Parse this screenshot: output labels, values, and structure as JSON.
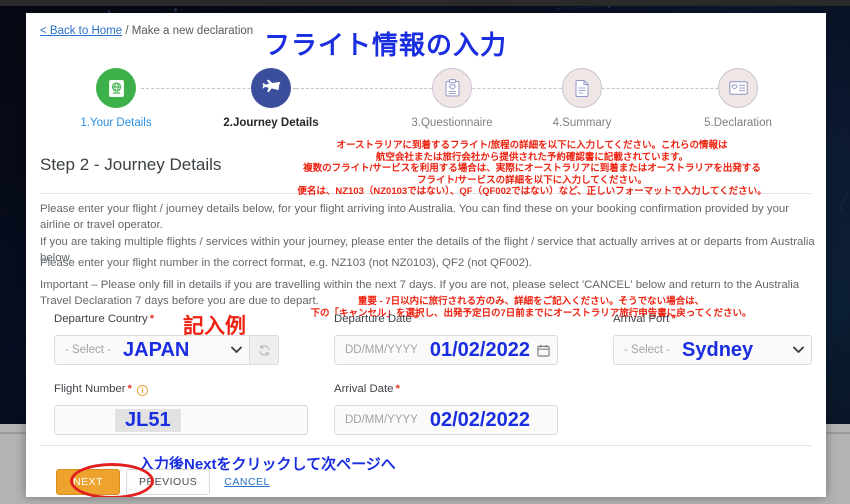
{
  "breadcrumb": {
    "back_link": "< Back to Home",
    "separator": " / ",
    "current": "Make a new declaration"
  },
  "annotations": {
    "title_jp": "フライト情報の入力",
    "red_note_lines": [
      "オーストラリアに到着するフライト/旅程の詳細を以下に入力してください。これらの情報は",
      "航空会社または旅行会社から提供された予約確認書に記載されています。",
      "複数のフライト/サービスを利用する場合は、実際にオーストラリアに到着またはオーストラリアを出発する",
      "フライト/サービスの詳細を以下に入力してください。",
      "便名は、NZ103（NZ0103ではない）、QF（QF002ではない）など、正しいフォーマットで入力してください。"
    ],
    "red_important_lines": [
      "重要 - 7日以内に旅行される方のみ、詳細をご記入ください。そうでない場合は、",
      "下の「キャンセル」を選択し、出発予定日の7日前までにオーストラリア旅行申告書に戻ってください。"
    ],
    "sample_label_jp": "記入例",
    "next_note_jp": "入力後Nextをクリックして次ページへ",
    "red_color": "#ee2211",
    "blue_color": "#1a2ee0"
  },
  "stepper": {
    "steps": [
      {
        "label": "1.Your Details",
        "icon": "passport-icon",
        "state": "done",
        "color": "#3cb14a"
      },
      {
        "label": "2.Journey Details",
        "icon": "airplane-icon",
        "state": "active",
        "color": "#3b4e9b"
      },
      {
        "label": "3.Questionnaire",
        "icon": "clipboard-icon",
        "state": "todo",
        "color": "#f0e6e6"
      },
      {
        "label": "4.Summary",
        "icon": "document-icon",
        "state": "todo",
        "color": "#f0e6e6"
      },
      {
        "label": "5.Declaration",
        "icon": "id-card-icon",
        "state": "todo",
        "color": "#f0e6e6"
      }
    ]
  },
  "page": {
    "heading": "Step 2 - Journey Details",
    "paragraphs": [
      "Please enter your flight / journey details below, for your flight arriving into Australia. You can find these on your booking confirmation provided by your airline or travel operator.",
      "If you are taking multiple flights / services within your journey, please enter the details of the flight / service that actually arrives at or departs from Australia below.",
      "Please enter your flight number in the correct format, e.g. NZ103 (not NZ0103), QF2 (not QF002).",
      "Important – Please only fill in details if you are travelling within the next 7 days.  If you are not, please select 'CANCEL' below and return to the Australia Travel Declaration 7 days before you are due to depart."
    ]
  },
  "form": {
    "departure_country": {
      "label": "Departure Country",
      "required": "*",
      "placeholder": "- Select -",
      "value": "JAPAN"
    },
    "departure_date": {
      "label": "Departure Date",
      "required": "*",
      "placeholder": "DD/MM/YYYY",
      "value": "01/02/2022"
    },
    "arrival_port": {
      "label": "Arrival Port",
      "required": "*",
      "placeholder": "- Select -",
      "value": "Sydney"
    },
    "flight_number": {
      "label": "Flight Number",
      "required": "*",
      "info": "i",
      "placeholder": "",
      "value": "JL51"
    },
    "arrival_date": {
      "label": "Arrival Date",
      "required": "*",
      "placeholder": "DD/MM/YYYY",
      "value": "02/02/2022"
    }
  },
  "footer": {
    "next_label": "NEXT",
    "previous_label": "PREVIOUS",
    "cancel_label": "CANCEL"
  }
}
